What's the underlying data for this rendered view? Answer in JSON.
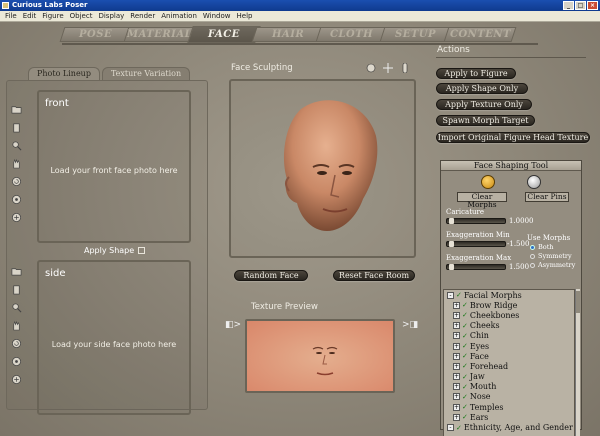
{
  "window": {
    "title": "Curious Labs Poser"
  },
  "menu": [
    "File",
    "Edit",
    "Figure",
    "Object",
    "Display",
    "Render",
    "Animation",
    "Window",
    "Help"
  ],
  "rooms": [
    {
      "label": "POSE",
      "active": false
    },
    {
      "label": "MATERIAL",
      "active": false
    },
    {
      "label": "FACE",
      "active": true
    },
    {
      "label": "HAIR",
      "active": false
    },
    {
      "label": "CLOTH",
      "active": false
    },
    {
      "label": "SETUP",
      "active": false
    },
    {
      "label": "CONTENT",
      "active": false
    }
  ],
  "photo_panel": {
    "tabs": [
      "Photo Lineup",
      "Texture Variation"
    ],
    "front": {
      "label": "front",
      "hint": "Load your front face photo here"
    },
    "apply_shape": "Apply Shape",
    "side": {
      "label": "side",
      "hint": "Load your side face photo here"
    }
  },
  "sculpt": {
    "title": "Face Sculpting",
    "random_face": "Random Face",
    "reset_face_room": "Reset Face Room",
    "texture_preview": "Texture Preview"
  },
  "actions": {
    "title": "Actions",
    "buttons": [
      "Apply to Figure",
      "Apply Shape Only",
      "Apply Texture Only",
      "Spawn Morph Target",
      "Import Original Figure Head Texture"
    ]
  },
  "shaping_tool": {
    "title": "Face Shaping Tool",
    "clear_morphs": "Clear Morphs",
    "clear_pins": "Clear Pins",
    "caricature": {
      "label": "Caricature",
      "value": "1.0000"
    },
    "exag_min": {
      "label": "Exaggeration Min",
      "value": "-1.500"
    },
    "exag_max": {
      "label": "Exaggeration Max",
      "value": "1.500"
    },
    "use_morphs": {
      "label": "Use Morphs",
      "options": [
        "Both",
        "Symmetry",
        "Asymmetry"
      ],
      "selected": "Both"
    },
    "tree": [
      {
        "label": "Facial Morphs",
        "level": 0,
        "box": "-"
      },
      {
        "label": "Brow Ridge",
        "level": 1,
        "box": "+"
      },
      {
        "label": "Cheekbones",
        "level": 1,
        "box": "+"
      },
      {
        "label": "Cheeks",
        "level": 1,
        "box": "+"
      },
      {
        "label": "Chin",
        "level": 1,
        "box": "+"
      },
      {
        "label": "Eyes",
        "level": 1,
        "box": "+"
      },
      {
        "label": "Face",
        "level": 1,
        "box": "+"
      },
      {
        "label": "Forehead",
        "level": 1,
        "box": "+"
      },
      {
        "label": "Jaw",
        "level": 1,
        "box": "+"
      },
      {
        "label": "Mouth",
        "level": 1,
        "box": "+"
      },
      {
        "label": "Nose",
        "level": 1,
        "box": "+"
      },
      {
        "label": "Temples",
        "level": 1,
        "box": "+"
      },
      {
        "label": "Ears",
        "level": 1,
        "box": "+"
      },
      {
        "label": "Ethnicity, Age, and Gender",
        "level": 0,
        "box": "-"
      }
    ]
  }
}
